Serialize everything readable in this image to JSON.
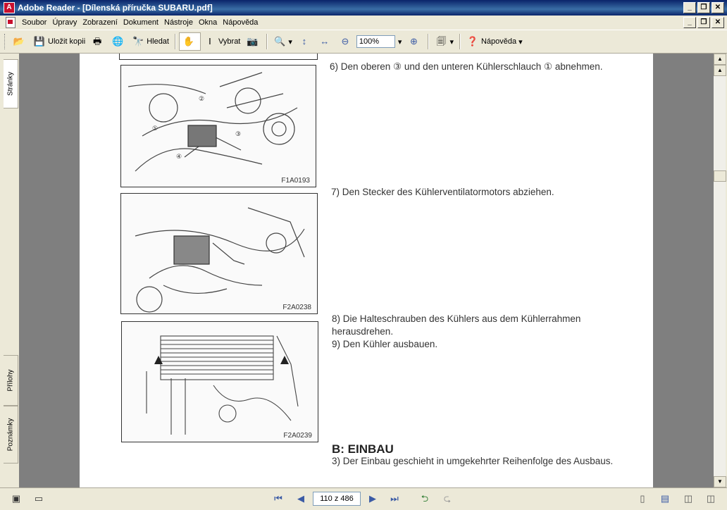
{
  "window": {
    "title": "Adobe Reader - [Dílenská příručka SUBARU.pdf]"
  },
  "menu": [
    "Soubor",
    "Úpravy",
    "Zobrazení",
    "Dokument",
    "Nástroje",
    "Okna",
    "Nápověda"
  ],
  "toolbar": {
    "save_copy": "Uložit kopii",
    "search": "Hledat",
    "select": "Vybrat",
    "zoom": "100%",
    "help": "Nápověda"
  },
  "sidebar": {
    "pages": "Stránky",
    "attachments": "Přílohy",
    "comments": "Poznámky"
  },
  "document": {
    "figures": [
      {
        "code": "F1A0193",
        "text": "6) Den oberen ③ und den unteren Kühlerschlauch ① abnehmen."
      },
      {
        "code": "F2A0238",
        "text": "7) Den Stecker des Kühlerventilatormotors abziehen."
      },
      {
        "code": "F2A0239",
        "text": "8) Die Halteschrauben des Kühlers aus dem Kühlerrahmen herausdrehen.\n9) Den Kühler ausbauen."
      }
    ],
    "heading": "B: EINBAU",
    "final_text": "3) Der Einbau geschieht in umgekehrter Reihenfolge des Ausbaus."
  },
  "status": {
    "page_display": "110 z 486"
  }
}
